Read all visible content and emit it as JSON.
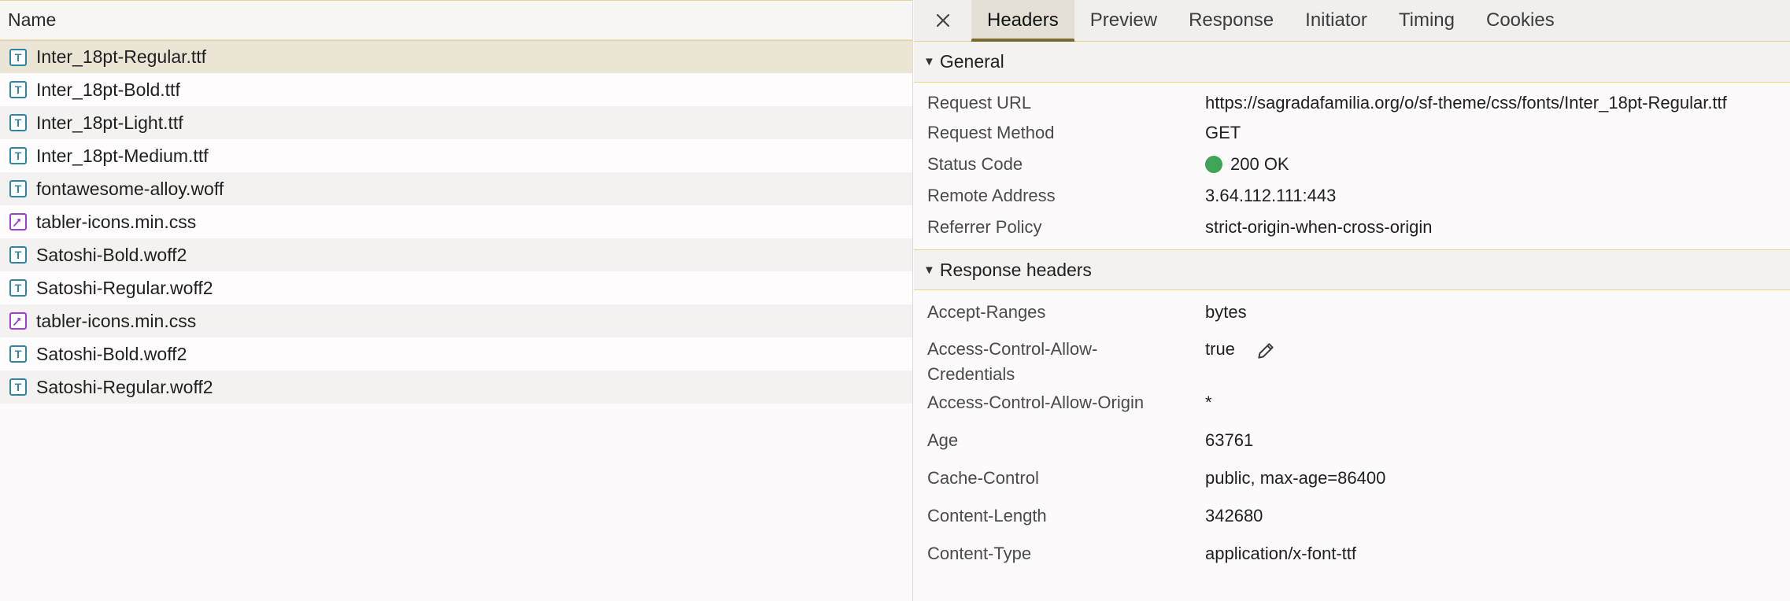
{
  "list": {
    "header": "Name",
    "items": [
      {
        "name": "Inter_18pt-Regular.ttf",
        "type": "font-icon"
      },
      {
        "name": "Inter_18pt-Bold.ttf",
        "type": "font-icon"
      },
      {
        "name": "Inter_18pt-Light.ttf",
        "type": "font-icon"
      },
      {
        "name": "Inter_18pt-Medium.ttf",
        "type": "font-icon"
      },
      {
        "name": "fontawesome-alloy.woff",
        "type": "font-icon"
      },
      {
        "name": "tabler-icons.min.css",
        "type": "stylesheet-icon"
      },
      {
        "name": "Satoshi-Bold.woff2",
        "type": "font-icon"
      },
      {
        "name": "Satoshi-Regular.woff2",
        "type": "font-icon"
      },
      {
        "name": "tabler-icons.min.css",
        "type": "stylesheet-icon"
      },
      {
        "name": "Satoshi-Bold.woff2",
        "type": "font-icon"
      },
      {
        "name": "Satoshi-Regular.woff2",
        "type": "font-icon"
      }
    ]
  },
  "tabs": {
    "close_icon": "close-icon",
    "items": [
      "Headers",
      "Preview",
      "Response",
      "Initiator",
      "Timing",
      "Cookies"
    ],
    "active": "Headers"
  },
  "general": {
    "title": "General",
    "rows": [
      {
        "k": "Request URL",
        "v": "https://sagradafamilia.org/o/sf-theme/css/fonts/Inter_18pt-Regular.ttf"
      },
      {
        "k": "Request Method",
        "v": "GET"
      },
      {
        "k": "Status Code",
        "v": "200 OK"
      },
      {
        "k": "Remote Address",
        "v": "3.64.112.111:443"
      },
      {
        "k": "Referrer Policy",
        "v": "strict-origin-when-cross-origin"
      }
    ]
  },
  "response_headers": {
    "title": "Response headers",
    "rows": [
      {
        "k": "Accept-Ranges",
        "v": "bytes"
      },
      {
        "k": "Access-Control-Allow-Credentials",
        "v": "true"
      },
      {
        "k": "Access-Control-Allow-Origin",
        "v": "*"
      },
      {
        "k": "Age",
        "v": "63761"
      },
      {
        "k": "Cache-Control",
        "v": "public, max-age=86400"
      },
      {
        "k": "Content-Length",
        "v": "342680"
      },
      {
        "k": "Content-Type",
        "v": "application/x-font-ttf"
      }
    ]
  },
  "colors": {
    "status_ok": "#3fa455",
    "accent_border": "#e8d48c",
    "font_icon": "#2f86a4",
    "css_icon": "#9d3fd4"
  }
}
